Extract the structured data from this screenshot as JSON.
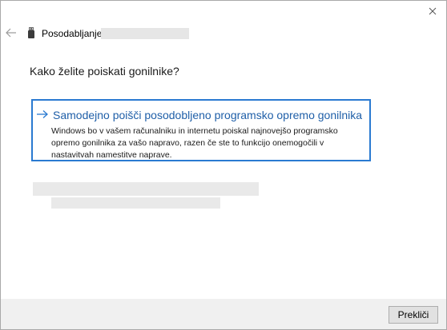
{
  "window": {
    "title": "Posodabljanje gonilnikov",
    "icons": {
      "close": "close-icon",
      "back": "back-arrow-icon",
      "device": "usb-device-icon"
    }
  },
  "main": {
    "heading": "Kako želite poiskati gonilnike?",
    "option": {
      "title": "Samodejno poišči posodobljeno programsko opremo gonilnika",
      "description": "Windows bo v vašem računalniku in internetu poiskal najnovejšo programsko opremo gonilnika za vašo napravo, razen če ste to funkcijo onemogočili v nastavitvah namestitve naprave.",
      "icon": "right-arrow-icon"
    }
  },
  "footer": {
    "cancel_label": "Prekliči"
  },
  "colors": {
    "accent": "#2a7ad1",
    "option_title": "#1f5fa8",
    "footer_bg": "#f0f0f0"
  }
}
